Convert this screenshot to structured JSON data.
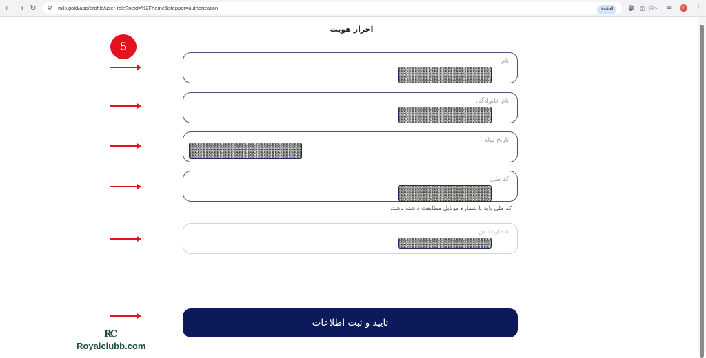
{
  "browser": {
    "url": "milli.gold/app/profile/user-role?next=%2Fhome&stepper=authorization",
    "install_label": "Install"
  },
  "page": {
    "title": "احراز هویت",
    "step_number": "5",
    "fields": [
      {
        "label": "نام"
      },
      {
        "label": "نام خانوادگی"
      },
      {
        "label": "تاریخ تولد"
      },
      {
        "label": "کد ملی"
      },
      {
        "label": "شماره تلفن"
      }
    ],
    "national_code_hint": "کد ملی باید با شماره موبایل مطابقت داشته باشد.",
    "submit_label": "تایید و ثبت اطلاعات"
  },
  "watermark": {
    "logo": "RC",
    "text": "Royalclubb.com"
  },
  "colors": {
    "accent_navy": "#0c1a5c",
    "annotation_red": "#e3121c"
  }
}
